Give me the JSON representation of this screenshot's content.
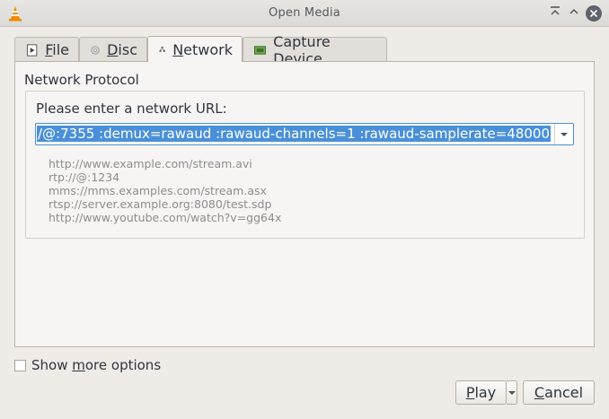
{
  "window": {
    "title": "Open Media"
  },
  "tabs": [
    {
      "label_pre": "",
      "label_u": "F",
      "label_post": "ile",
      "icon": "file-icon"
    },
    {
      "label_pre": "",
      "label_u": "D",
      "label_post": "isc",
      "icon": "disc-icon"
    },
    {
      "label_pre": "",
      "label_u": "N",
      "label_post": "etwork",
      "icon": "network-icon"
    },
    {
      "label_pre": "Capture ",
      "label_u": "D",
      "label_post": "evice",
      "icon": "capture-device-icon"
    }
  ],
  "active_tab": "Network",
  "network": {
    "group_title": "Network Protocol",
    "url_label": "Please enter a network URL:",
    "url_value": "/@:7355  :demux=rawaud :rawaud-channels=1 :rawaud-samplerate=48000",
    "examples": [
      "http://www.example.com/stream.avi",
      "rtp://@:1234",
      "mms://mms.examples.com/stream.asx",
      "rtsp://server.example.org:8080/test.sdp",
      "http://www.youtube.com/watch?v=gg64x"
    ]
  },
  "options": {
    "show_more_pre": "Show ",
    "show_more_u": "m",
    "show_more_post": "ore options",
    "checked": false
  },
  "buttons": {
    "play_u": "P",
    "play_post": "lay",
    "cancel_u": "C",
    "cancel_post": "ancel"
  }
}
